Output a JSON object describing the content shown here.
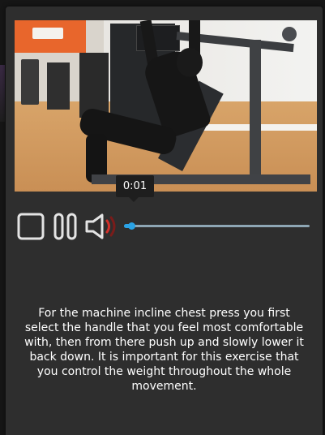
{
  "player": {
    "current_time": "0:01",
    "progress_fraction": 0.015,
    "volume_state": "sound-on",
    "accent_color": "#2aa3e6",
    "track_color": "#8ea6b4",
    "volume_wave_color": "#d2302a",
    "controls": {
      "stop_icon": "stop-icon",
      "pause_icon": "pause-icon",
      "volume_icon": "speaker-icon"
    }
  },
  "description": {
    "text": "For the machine incline chest press you first select the handle that you feel most comfortable with, then from there push up and slowly lower it back down. It is important for this exercise that you control the weight throughout the whole movement."
  }
}
